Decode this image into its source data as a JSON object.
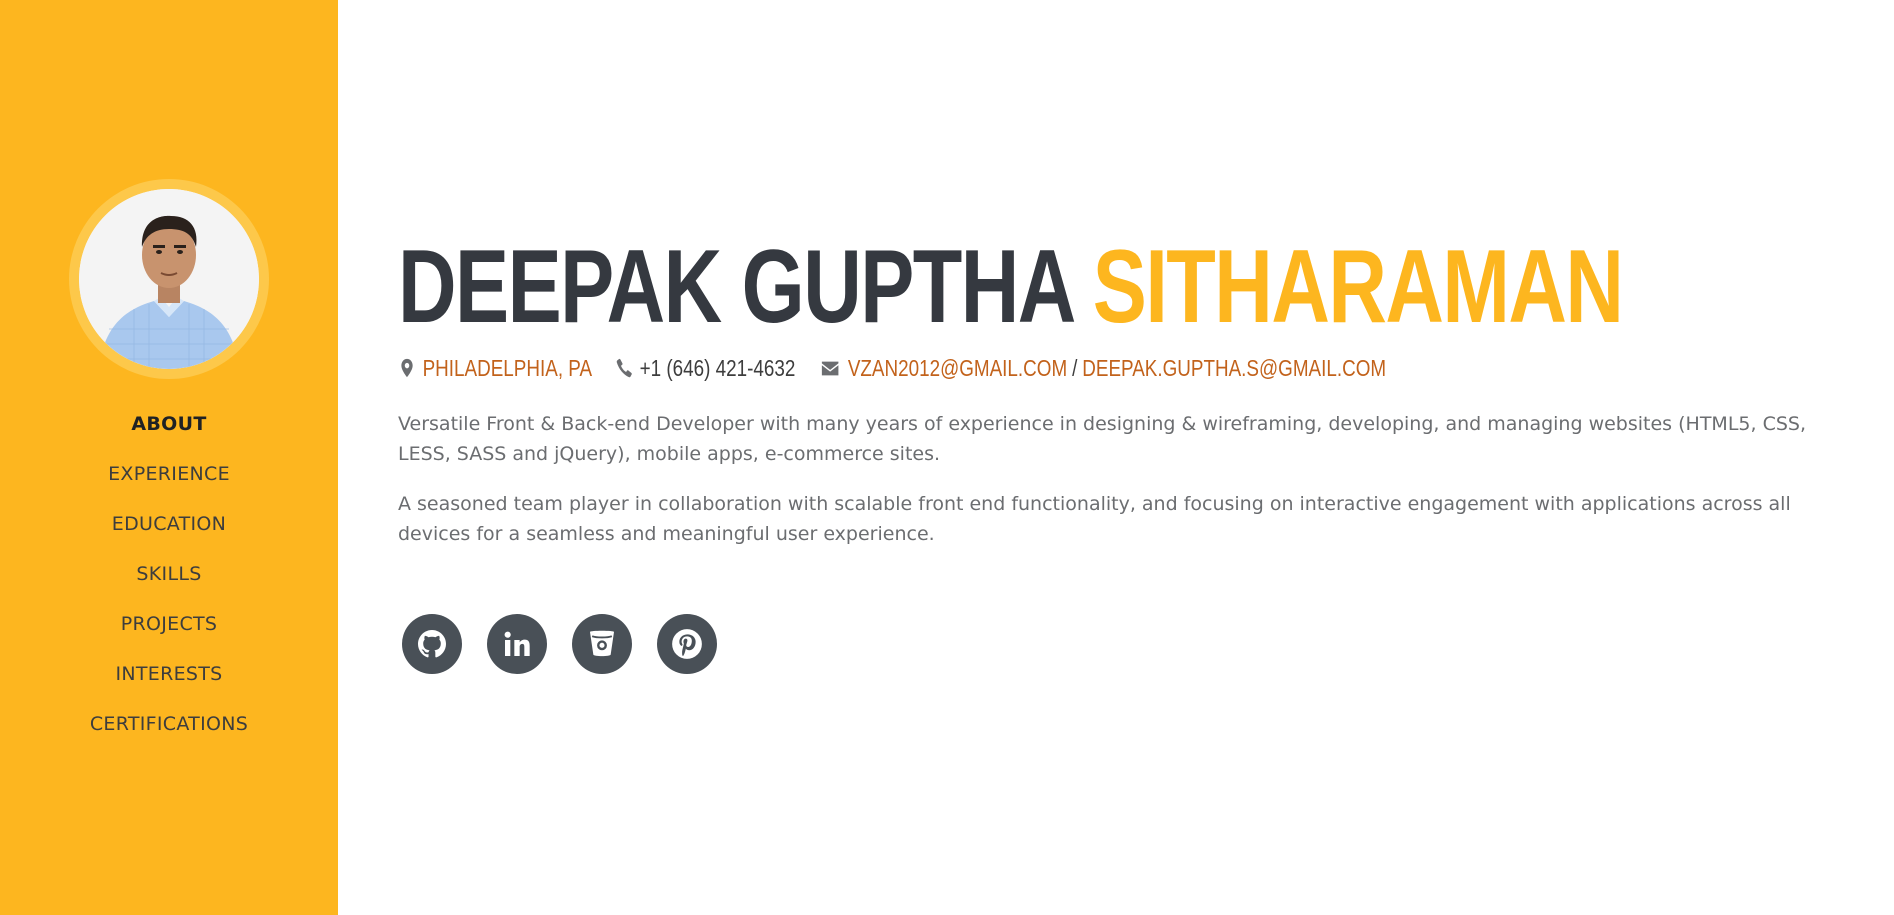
{
  "colors": {
    "sidebar": "#fdb61f",
    "accent": "#fdb61f",
    "link": "#c2621b",
    "heading": "#353940",
    "social_bg": "#495057"
  },
  "sidebar": {
    "avatar_alt": "profile photo",
    "nav": [
      {
        "label": "ABOUT",
        "active": true
      },
      {
        "label": "EXPERIENCE",
        "active": false
      },
      {
        "label": "EDUCATION",
        "active": false
      },
      {
        "label": "SKILLS",
        "active": false
      },
      {
        "label": "PROJECTS",
        "active": false
      },
      {
        "label": "INTERESTS",
        "active": false
      },
      {
        "label": "CERTIFICATIONS",
        "active": false
      }
    ]
  },
  "header": {
    "first_name": "DEEPAK GUPTHA",
    "last_name": "SITHARAMAN"
  },
  "contact": {
    "location": "PHILADELPHIA, PA",
    "phone": "+1 (646) 421-4632",
    "email_primary": "VZAN2012@GMAIL.COM",
    "email_separator": "/",
    "email_secondary": "DEEPAK.GUPTHA.S@GMAIL.COM",
    "icons": [
      "map-marker-icon",
      "phone-icon",
      "envelope-icon"
    ]
  },
  "bio": [
    "Versatile Front & Back-end Developer with many years of experience in designing & wireframing, developing, and managing websites (HTML5, CSS, LESS, SASS and jQuery), mobile apps, e-commerce sites.",
    "A seasoned team player in collaboration with scalable front end functionality, and focusing on interactive engagement with applications across all devices for a seamless and meaningful user experience."
  ],
  "social": [
    {
      "icon": "github-icon"
    },
    {
      "icon": "linkedin-icon"
    },
    {
      "icon": "bitbucket-icon"
    },
    {
      "icon": "pinterest-icon"
    }
  ]
}
